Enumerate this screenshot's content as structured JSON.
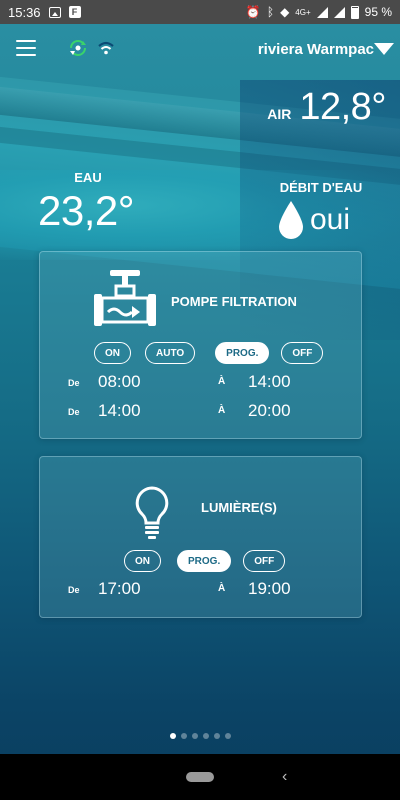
{
  "status_bar": {
    "time": "15:36",
    "network": "4G+",
    "battery": "95 %"
  },
  "header": {
    "brand": "riviera Warmpac",
    "icons": [
      "menu-icon",
      "sync-icon",
      "wifi-icon",
      "brand-arrow-icon"
    ]
  },
  "air": {
    "label": "AIR",
    "value": "12,8°"
  },
  "eau": {
    "label": "EAU",
    "value": "23,2°"
  },
  "debit": {
    "label": "DÉBIT D'EAU",
    "value": "oui"
  },
  "pompe": {
    "title": "POMPE FILTRATION",
    "buttons": [
      "ON",
      "AUTO",
      "PROG.",
      "OFF"
    ],
    "active_button": "PROG.",
    "schedules": [
      {
        "de": "De",
        "from": "08:00",
        "a": "À",
        "to": "14:00"
      },
      {
        "de": "De",
        "from": "14:00",
        "a": "À",
        "to": "20:00"
      }
    ]
  },
  "lumiere": {
    "title": "LUMIÈRE(S)",
    "buttons": [
      "ON",
      "PROG.",
      "OFF"
    ],
    "active_button": "PROG.",
    "schedules": [
      {
        "de": "De",
        "from": "17:00",
        "a": "À",
        "to": "19:00"
      }
    ]
  },
  "pager": {
    "count": 6,
    "active": 0
  },
  "colors": {
    "accent_text": "#1d6a86",
    "sync_green": "#3ad36b"
  }
}
